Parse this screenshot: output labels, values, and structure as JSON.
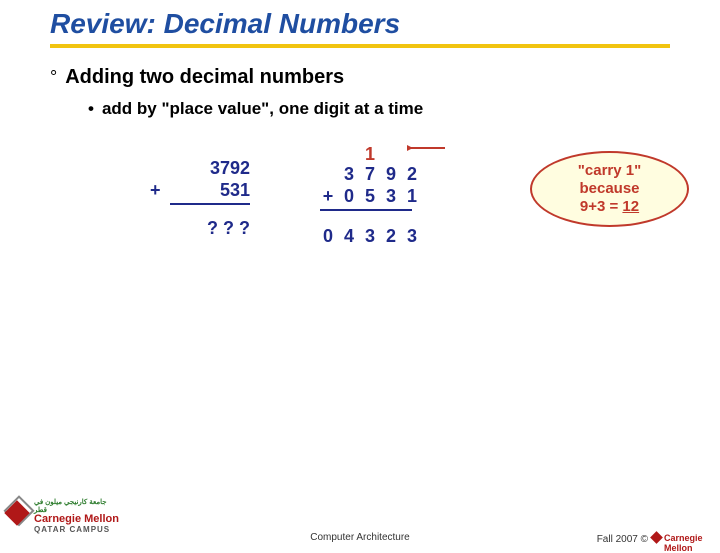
{
  "title": "Review: Decimal Numbers",
  "heading": "Adding two decimal numbers",
  "subbullet": "add by \"place value\", one digit at a time",
  "left_add": {
    "n1": "3792",
    "plus": "+",
    "n2": "531",
    "result": "? ? ?"
  },
  "right_add": {
    "carry": "1",
    "row1": {
      "d0": "3",
      "d1": "7",
      "d2": "9",
      "d3": "2"
    },
    "row2_plus": "+",
    "row2": {
      "d0": "0",
      "d1": "5",
      "d2": "3",
      "d3": "1"
    },
    "res": {
      "d0": "0",
      "d1": "4",
      "d2": "3",
      "d3": "2",
      "d4": "3"
    }
  },
  "callout": {
    "l1": "\"carry 1\"",
    "l2": "because",
    "l3a": "9+3 = ",
    "l3b": "12"
  },
  "footer_center": "Computer Architecture",
  "footer_right": "Fall 2007 ©",
  "logo": {
    "cm": "Carnegie Mellon",
    "qc": "QATAR CAMPUS",
    "ar": "جامعة كارنيجي ميلون في قطر"
  }
}
